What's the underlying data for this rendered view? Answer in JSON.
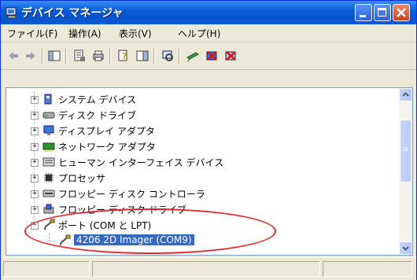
{
  "window": {
    "title": "デバイス マネージャ",
    "accent_color": "#0a5ed8"
  },
  "menu": {
    "items": [
      {
        "label": "ファイル(F)"
      },
      {
        "label": "操作(A)"
      },
      {
        "label": "表示(V)"
      },
      {
        "label": "ヘルプ(H)"
      }
    ]
  },
  "toolbar": {
    "buttons": [
      {
        "icon": "back-arrow-icon"
      },
      {
        "icon": "forward-arrow-icon"
      },
      {
        "icon": "console-tree-icon"
      },
      {
        "icon": "properties-icon"
      },
      {
        "icon": "print-icon"
      },
      {
        "icon": "help-icon"
      },
      {
        "icon": "view-icon"
      },
      {
        "icon": "scan-hardware-icon"
      },
      {
        "icon": "update-driver-icon"
      },
      {
        "icon": "disable-device-icon"
      },
      {
        "icon": "uninstall-device-icon"
      }
    ]
  },
  "tree": {
    "items": [
      {
        "label": "システム デバイス",
        "expander": "+",
        "icon": "system-devices-icon"
      },
      {
        "label": "ディスク ドライブ",
        "expander": "+",
        "icon": "disk-drive-icon"
      },
      {
        "label": "ディスプレイ アダプタ",
        "expander": "+",
        "icon": "display-adapter-icon"
      },
      {
        "label": "ネットワーク アダプタ",
        "expander": "+",
        "icon": "network-adapter-icon"
      },
      {
        "label": "ヒューマン インターフェイス デバイス",
        "expander": "+",
        "icon": "hid-icon"
      },
      {
        "label": "プロセッサ",
        "expander": "+",
        "icon": "processor-icon"
      },
      {
        "label": "フロッピー ディスク コントローラ",
        "expander": "+",
        "icon": "floppy-controller-icon"
      },
      {
        "label": "フロッピー ディスク ドライブ",
        "expander": "+",
        "icon": "floppy-drive-icon"
      },
      {
        "label": "ポート (COM と LPT)",
        "expander": "−",
        "icon": "port-icon"
      }
    ],
    "child": {
      "label": "4206 2D Imager (COM9)",
      "icon": "port-device-icon",
      "selected": true
    }
  },
  "annotation": {
    "highlight_color": "#e8262d"
  }
}
